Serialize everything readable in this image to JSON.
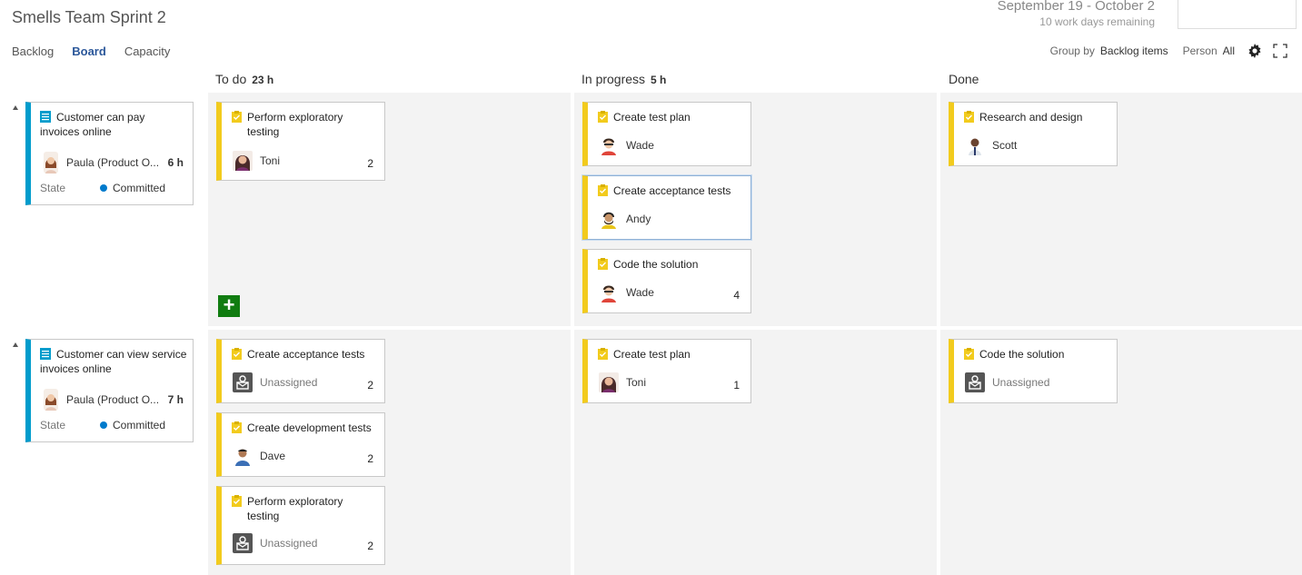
{
  "header": {
    "title": "Smells Team Sprint 2",
    "date_range": "September 19 - October 2",
    "remaining": "10 work days remaining"
  },
  "pivots": [
    "Backlog",
    "Board",
    "Capacity"
  ],
  "toolbar": {
    "group_by_label": "Group by",
    "group_by_value": "Backlog items",
    "person_label": "Person",
    "person_value": "All"
  },
  "columns": [
    {
      "name": "To do",
      "hours": "23 h"
    },
    {
      "name": "In progress",
      "hours": "5 h"
    },
    {
      "name": "Done",
      "hours": ""
    }
  ],
  "state_label": "State",
  "rows": [
    {
      "pbi": {
        "title": "Customer can pay invoices online",
        "owner": "Paula (Product O...",
        "hours": "6 h",
        "state": "Committed"
      },
      "todo": [
        {
          "title": "Perform exploratory testing",
          "person": "Toni",
          "remaining": "2"
        }
      ],
      "inprogress": [
        {
          "title": "Create test plan",
          "person": "Wade",
          "remaining": ""
        },
        {
          "title": "Create acceptance tests",
          "person": "Andy",
          "remaining": ""
        },
        {
          "title": "Code the solution",
          "person": "Wade",
          "remaining": "4"
        }
      ],
      "done": [
        {
          "title": "Research and design",
          "person": "Scott",
          "remaining": ""
        }
      ]
    },
    {
      "pbi": {
        "title": "Customer can view service invoices online",
        "owner": "Paula (Product O...",
        "hours": "7 h",
        "state": "Committed"
      },
      "todo": [
        {
          "title": "Create acceptance tests",
          "person": "Unassigned",
          "remaining": "2"
        },
        {
          "title": "Create development tests",
          "person": "Dave",
          "remaining": "2"
        },
        {
          "title": "Perform exploratory testing",
          "person": "Unassigned",
          "remaining": "2"
        }
      ],
      "inprogress": [
        {
          "title": "Create test plan",
          "person": "Toni",
          "remaining": "1"
        }
      ],
      "done": [
        {
          "title": "Code the solution",
          "person": "Unassigned",
          "remaining": ""
        }
      ]
    }
  ],
  "colors": {
    "task_accent": "#f2cb1d",
    "pbi_accent": "#009ccc",
    "committed_dot": "#007acc",
    "add_button": "#107c10",
    "active_pivot": "#2b579a"
  }
}
